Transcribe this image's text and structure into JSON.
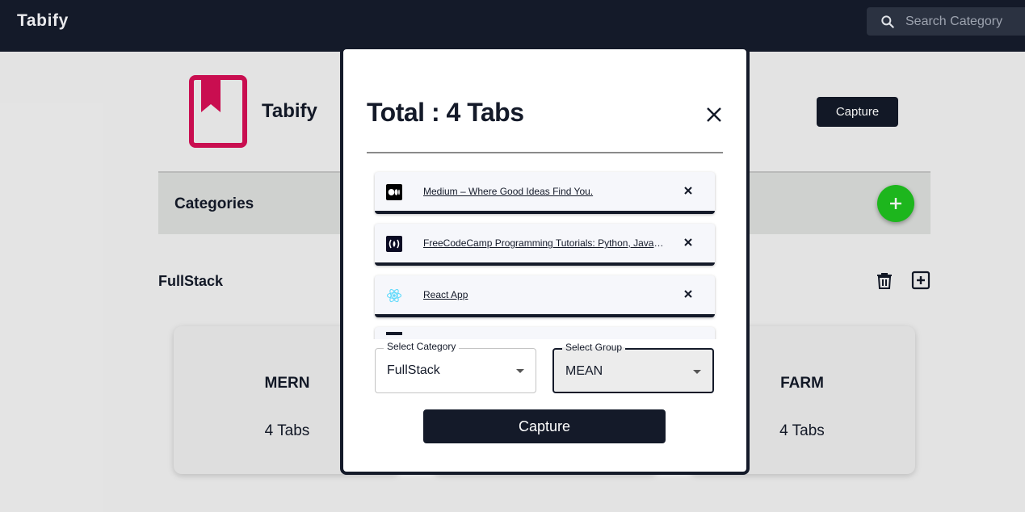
{
  "navbar": {
    "brand": "Tabify",
    "search_placeholder": "Search Category"
  },
  "hero": {
    "title": "Tabify",
    "capture_label": "Capture",
    "accent_color": "#d60f56"
  },
  "categories": {
    "title": "Categories"
  },
  "group": {
    "name": "FullStack",
    "cards": [
      {
        "name": "MERN",
        "count": "4 Tabs"
      },
      {
        "name": "",
        "count": ""
      },
      {
        "name": "FARM",
        "count": "4 Tabs"
      }
    ]
  },
  "modal": {
    "title": "Total : 4 Tabs",
    "tabs": [
      {
        "title": "Medium – Where Good Ideas Find You.",
        "favicon": "medium-icon"
      },
      {
        "title": "FreeCodeCamp Programming Tutorials: Python, JavaScript, Git & More",
        "favicon": "freecodecamp-icon"
      },
      {
        "title": "React App",
        "favicon": "react-icon"
      }
    ],
    "category_select": {
      "label": "Select Category",
      "value": "FullStack"
    },
    "group_select": {
      "label": "Select Group",
      "value": "MEAN"
    },
    "capture_label": "Capture"
  },
  "colors": {
    "dark": "#141a29",
    "fab": "#1fc21f"
  }
}
